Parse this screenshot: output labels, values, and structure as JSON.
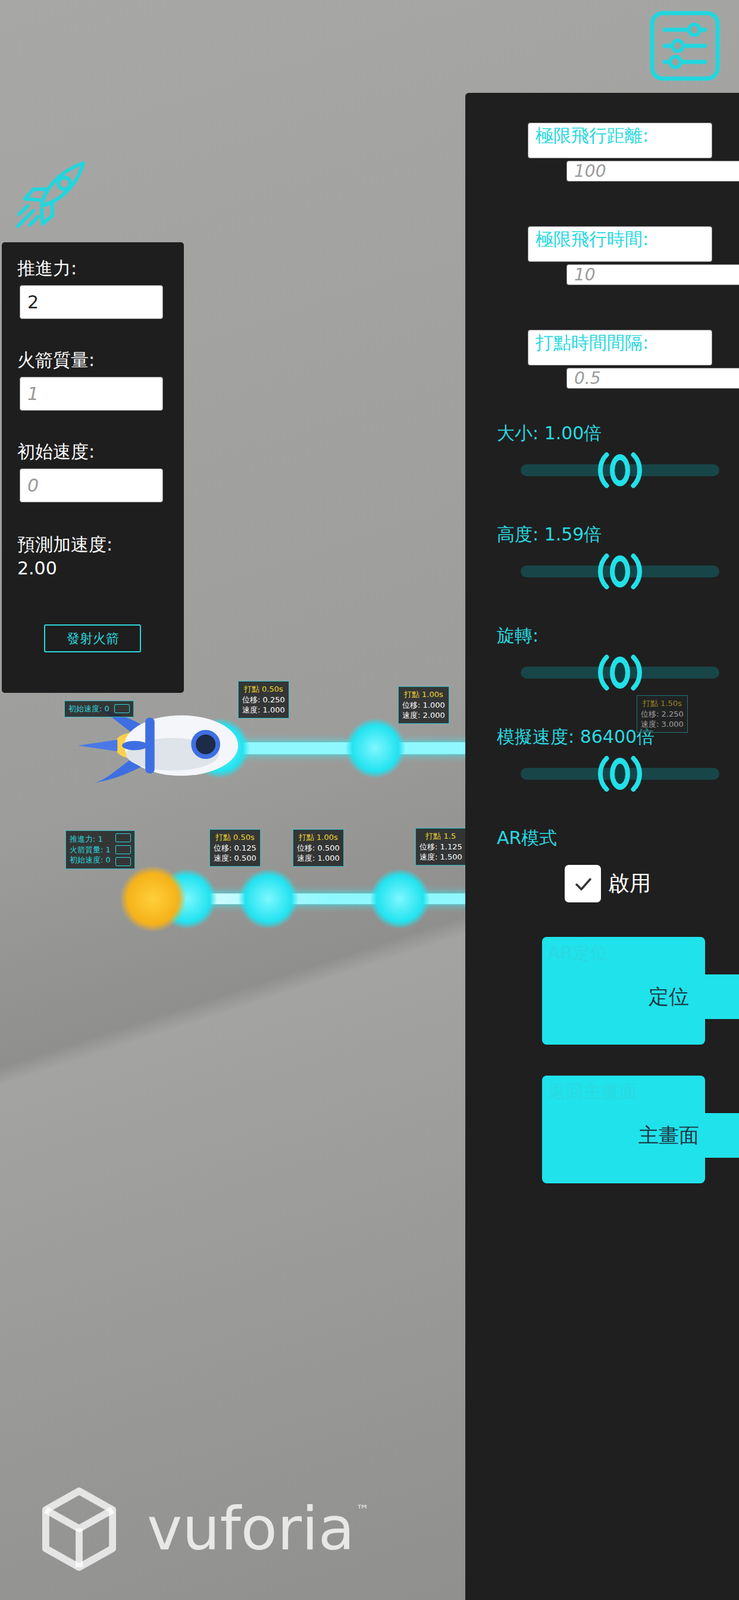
{
  "launch_panel": {
    "fields": [
      {
        "label": "推進力:",
        "value": "2"
      },
      {
        "label": "火箭質量:",
        "placeholder": "1"
      },
      {
        "label": "初始速度:",
        "placeholder": "0"
      }
    ],
    "prediction": {
      "label": "預測加速度:",
      "value": "2.00"
    },
    "button": "發射火箭"
  },
  "settings_panel": {
    "items": [
      {
        "kind": "input",
        "label": "極限飛行距離:",
        "placeholder": "100"
      },
      {
        "kind": "input",
        "label": "極限飛行時間:",
        "placeholder": "10"
      },
      {
        "kind": "input",
        "label": "打點時間間隔:",
        "placeholder": "0.5"
      },
      {
        "kind": "slider",
        "label": "大小: 1.00倍",
        "level": 0.5
      },
      {
        "kind": "slider",
        "label": "高度: 1.59倍",
        "level": 0.5
      },
      {
        "kind": "slider",
        "label": "旋轉:",
        "level": 0.5
      },
      {
        "kind": "slider",
        "label": "模擬速度: 86400倍",
        "level": 0.5
      },
      {
        "kind": "checkbox",
        "label": "AR模式",
        "option": "啟用",
        "checked": true
      },
      {
        "kind": "button",
        "label": "AR定位",
        "button": "定位"
      },
      {
        "kind": "button",
        "label": "返回主畫面",
        "button": "主畫面"
      }
    ]
  },
  "tracks": [
    {
      "kind": "rocket",
      "info": [
        "初始速度: 0"
      ],
      "labels": [
        {
          "title": "打點 0.50s",
          "lines": [
            "位移: 0.250",
            "速度: 1.000"
          ],
          "faded": false
        },
        {
          "title": "打點 1.00s",
          "lines": [
            "位移: 1.000",
            "速度: 2.000"
          ],
          "faded": false
        },
        {
          "title": "打點 1.50s",
          "lines": [
            "位移: 2.250",
            "速度: 3.000"
          ],
          "faded": true
        }
      ]
    },
    {
      "kind": "ball",
      "info": [
        "推進力: 1",
        "火箭質量: 1",
        "初始速度: 0"
      ],
      "labels": [
        {
          "title": "打點 0.50s",
          "lines": [
            "位移: 0.125",
            "速度: 0.500"
          ],
          "faded": false
        },
        {
          "title": "打點 1.00s",
          "lines": [
            "位移: 0.500",
            "速度: 1.000"
          ],
          "faded": false
        },
        {
          "title": "打點 1.5",
          "lines": [
            "位移: 1.125",
            "速度: 1.500"
          ],
          "faded": false
        }
      ]
    }
  ],
  "watermark": {
    "text": "vuforia",
    "mark": "™"
  }
}
